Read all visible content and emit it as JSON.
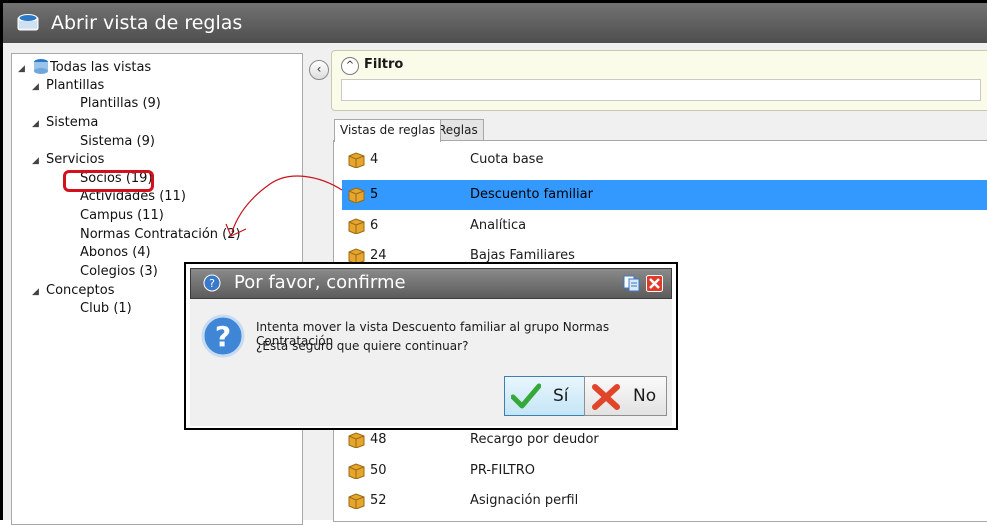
{
  "window": {
    "title": "Abrir vista de reglas",
    "icon": "database-folder-icon"
  },
  "tree": {
    "root": "Todas las vistas",
    "groups": [
      {
        "label": "Plantillas",
        "children": [
          "Plantillas (9)"
        ]
      },
      {
        "label": "Sistema",
        "children": [
          "Sistema (9)"
        ]
      },
      {
        "label": "Servicios",
        "children": [
          "Socios (19)",
          "Actividades (11)",
          "Campus (11)",
          "Normas Contratación (2)",
          "Abonos (4)",
          "Colegios (3)"
        ]
      },
      {
        "label": "Conceptos",
        "children": [
          "Club (1)"
        ]
      }
    ]
  },
  "filter": {
    "label": "Filtro",
    "value": ""
  },
  "tabs": [
    "Vistas de reglas",
    "Reglas"
  ],
  "list": {
    "rows": [
      {
        "num": "4",
        "name": "Cuota base"
      },
      {
        "num": "5",
        "name": "Descuento familiar",
        "selected": true
      },
      {
        "num": "6",
        "name": "Analítica"
      },
      {
        "num": "24",
        "name": "Bajas Familiares"
      },
      {
        "num": "48",
        "name": "Recargo por deudor"
      },
      {
        "num": "50",
        "name": "PR-FILTRO"
      },
      {
        "num": "52",
        "name": "Asignación perfil"
      }
    ]
  },
  "dialog": {
    "title": "Por favor, confirme",
    "message_line1": "Intenta mover la vista Descuento familiar al grupo Normas Contratación",
    "message_line2": "¿Está seguro que quiere continuar?",
    "yes_label": "Sí",
    "no_label": "No"
  },
  "colors": {
    "selection": "#3399ff",
    "annotation": "#d3101c",
    "titlebar": "#5a5a5a"
  }
}
